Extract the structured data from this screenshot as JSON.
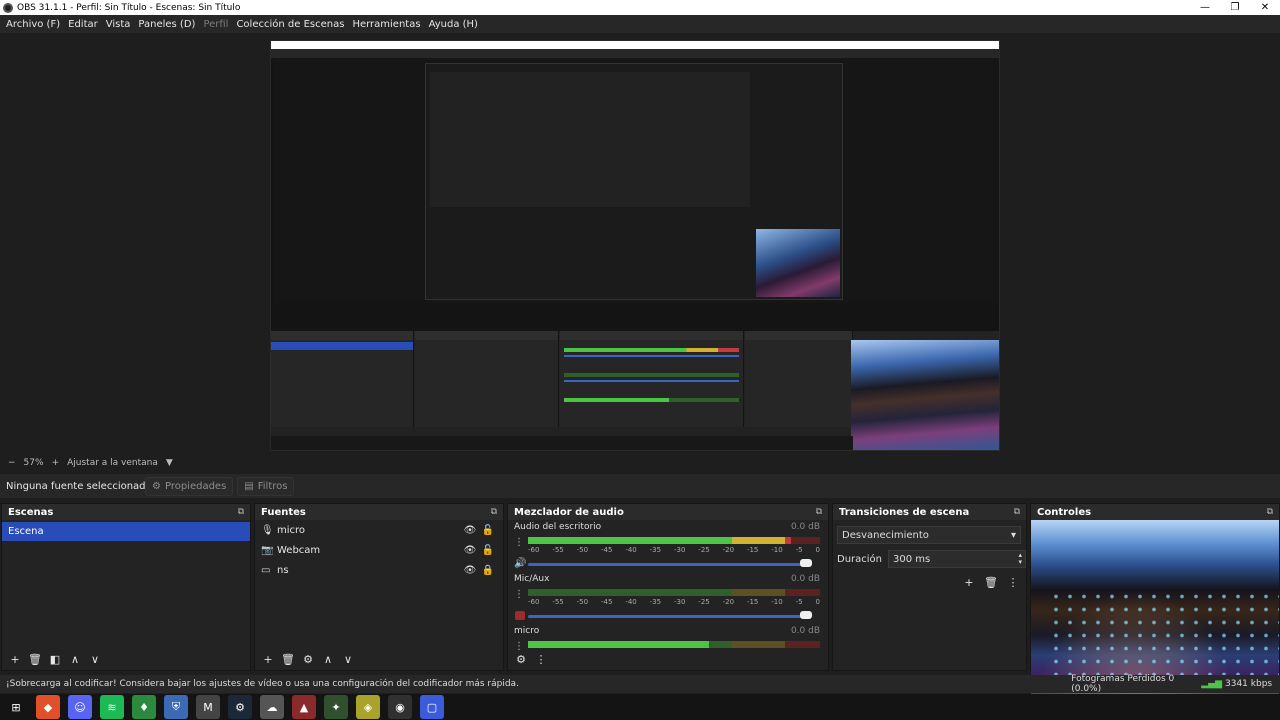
{
  "window": {
    "title": "OBS 31.1.1 - Perfil: Sin Título - Escenas: Sin Título",
    "minimize": "—",
    "maximize": "❐",
    "close": "✕"
  },
  "menu": [
    {
      "label": "Archivo (F)",
      "disabled": false
    },
    {
      "label": "Editar",
      "disabled": false
    },
    {
      "label": "Vista",
      "disabled": false
    },
    {
      "label": "Paneles (D)",
      "disabled": false
    },
    {
      "label": "Perfil",
      "disabled": true
    },
    {
      "label": "Colección de Escenas",
      "disabled": false
    },
    {
      "label": "Herramientas",
      "disabled": false
    },
    {
      "label": "Ayuda (H)",
      "disabled": false
    }
  ],
  "zoom": {
    "minus": "−",
    "value": "57%",
    "plus": "+",
    "fit_label": "Ajustar a la ventana",
    "dropdown": "▼"
  },
  "context": {
    "no_source": "Ninguna fuente seleccionada",
    "properties": "Propiedades",
    "filters": "Filtros"
  },
  "scenes": {
    "title": "Escenas",
    "items": [
      "Escena"
    ]
  },
  "sources": {
    "title": "Fuentes",
    "items": [
      {
        "name": "micro",
        "icon": "microphone-icon"
      },
      {
        "name": "Webcam",
        "icon": "camera-icon"
      },
      {
        "name": "ns",
        "icon": "monitor-icon"
      }
    ]
  },
  "mixer": {
    "title": "Mezclador de audio",
    "channels": [
      {
        "name": "Audio del escritorio",
        "db": "0.0 dB",
        "level": 0.9,
        "muted": false
      },
      {
        "name": "Mic/Aux",
        "db": "0.0 dB",
        "level": 0.0,
        "muted": true
      },
      {
        "name": "micro",
        "db": "0.0 dB",
        "level": 0.62,
        "muted": false
      }
    ],
    "ticks": [
      "-60",
      "-55",
      "-50",
      "-45",
      "-40",
      "-35",
      "-30",
      "-25",
      "-20",
      "-15",
      "-10",
      "-5",
      "0"
    ]
  },
  "transitions": {
    "title": "Transiciones de escena",
    "selected": "Desvanecimiento",
    "duration_label": "Duración",
    "duration_value": "300 ms"
  },
  "controls": {
    "title": "Controles"
  },
  "status": {
    "message": "¡Sobrecarga al codificar! Considera bajar los ajustes de vídeo o usa una configuración del codificador más rápida.",
    "frames": "Fotogramas Perdidos 0 (0.0%)",
    "kbps": "3341 kbps"
  },
  "taskbar": [
    {
      "icon": "windows-start-icon",
      "color": "#141414",
      "glyph": "⊞"
    },
    {
      "icon": "brave-icon",
      "color": "#e0502b",
      "glyph": "◆"
    },
    {
      "icon": "discord-icon",
      "color": "#5865f2",
      "glyph": "☺"
    },
    {
      "icon": "spotify-icon",
      "color": "#1db954",
      "glyph": "≋"
    },
    {
      "icon": "mic-app-icon",
      "color": "#2b8a3e",
      "glyph": "♦"
    },
    {
      "icon": "shield-app-icon",
      "color": "#3b6bb5",
      "glyph": "⛨"
    },
    {
      "icon": "m-app-icon",
      "color": "#444444",
      "glyph": "M"
    },
    {
      "icon": "steam-icon",
      "color": "#1b2838",
      "glyph": "⚙"
    },
    {
      "icon": "cloud-app-icon",
      "color": "#555555",
      "glyph": "☁"
    },
    {
      "icon": "game-app-icon",
      "color": "#8a2a2a",
      "glyph": "▲"
    },
    {
      "icon": "valorant-app-icon",
      "color": "#2f4f2f",
      "glyph": "✦"
    },
    {
      "icon": "yellow-app-icon",
      "color": "#a9a22b",
      "glyph": "◈"
    },
    {
      "icon": "obs-icon",
      "color": "#303030",
      "glyph": "◉"
    },
    {
      "icon": "blue-app-icon",
      "color": "#3b5bdb",
      "glyph": "▢"
    }
  ]
}
